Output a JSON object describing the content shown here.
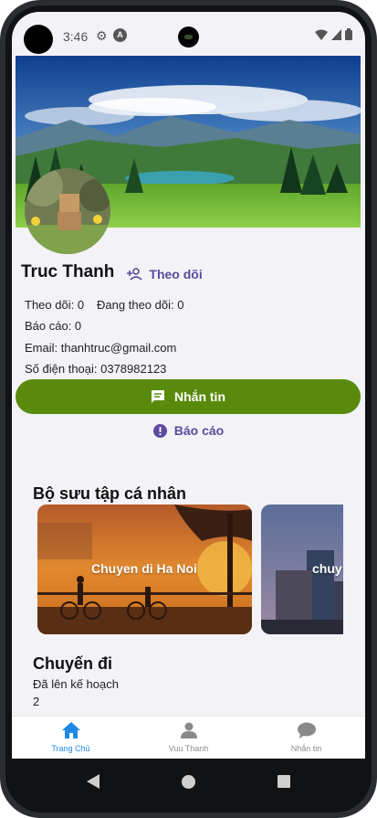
{
  "status_bar": {
    "time": "3:46",
    "badge_letter": "A"
  },
  "profile": {
    "name": "Truc Thanh",
    "follow_label": "Theo dõi",
    "following_stats": {
      "followers": "Theo dõi: 0",
      "following": "Đang theo dõi: 0"
    },
    "reports": "Báo cáo: 0",
    "email": "Email: thanhtruc@gmail.com",
    "phone": "Số điện thoại: 0378982123"
  },
  "actions": {
    "message_label": "Nhắn tin",
    "report_label": "Báo cáo"
  },
  "collection": {
    "title": "Bộ sưu tập cá nhân",
    "cards": [
      {
        "label": "Chuyen di Ha Noi"
      },
      {
        "label": "chuy"
      }
    ]
  },
  "trips": {
    "title": "Chuyến đi",
    "planned_label": "Đã lên kế hoạch",
    "planned_count": "2"
  },
  "bottom_nav": {
    "items": [
      {
        "label": "Trang Chủ",
        "icon": "home-icon",
        "active": true
      },
      {
        "label": "Vuu Thanh",
        "icon": "person-icon",
        "active": false
      },
      {
        "label": "Nhắn tin",
        "icon": "chat-icon",
        "active": false
      }
    ]
  },
  "colors": {
    "accent_green": "#5a8a0b",
    "accent_purple": "#5b4a9e",
    "active_nav": "#1e88e5"
  }
}
